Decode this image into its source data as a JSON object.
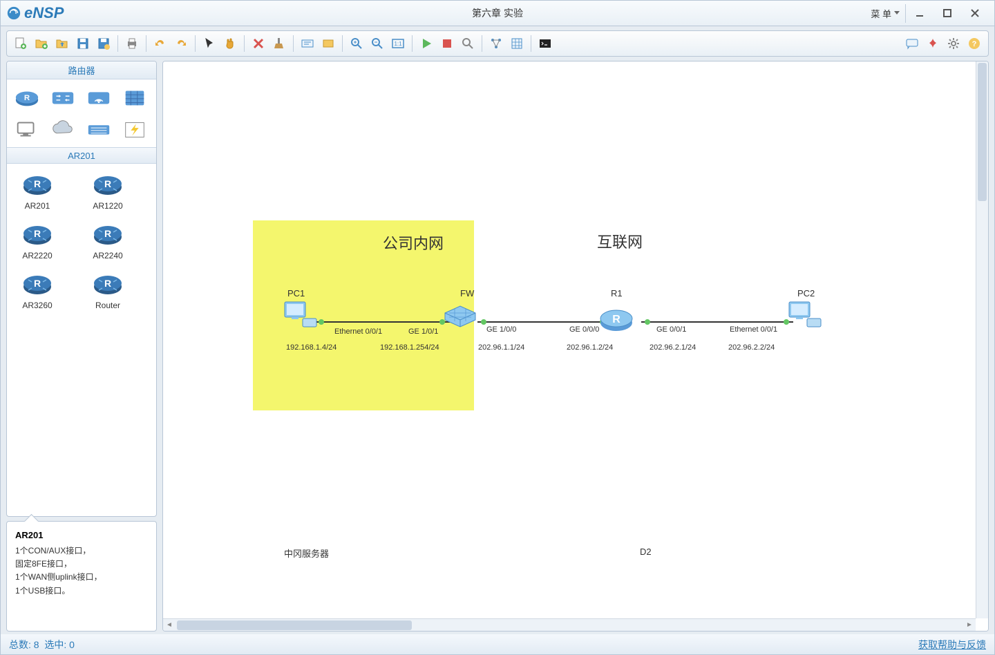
{
  "app": {
    "name": "eNSP",
    "title": "第六章 实验"
  },
  "menu": {
    "label": "菜  单"
  },
  "sidebar": {
    "category_title": "路由器",
    "selected_model": "AR201",
    "devices": [
      {
        "label": "AR201"
      },
      {
        "label": "AR1220"
      },
      {
        "label": "AR2220"
      },
      {
        "label": "AR2240"
      },
      {
        "label": "AR3260"
      },
      {
        "label": "Router"
      }
    ],
    "info": {
      "title": "AR201",
      "desc": "1个CON/AUX接口，\n固定8FE接口，\n1个WAN侧uplink接口，\n1个USB接口。"
    }
  },
  "topology": {
    "zones": [
      {
        "label": "公司内网",
        "color": "#f4f66d"
      },
      {
        "label": "互联网"
      }
    ],
    "nodes": [
      {
        "id": "PC1",
        "label": "PC1",
        "type": "pc"
      },
      {
        "id": "FW",
        "label": "FW",
        "type": "firewall"
      },
      {
        "id": "R1",
        "label": "R1",
        "type": "router"
      },
      {
        "id": "PC2",
        "label": "PC2",
        "type": "pc"
      }
    ],
    "ports": [
      "Ethernet 0/0/1",
      "GE 1/0/1",
      "GE 1/0/0",
      "GE 0/0/0",
      "GE 0/0/1",
      "Ethernet 0/0/1"
    ],
    "ips": [
      "192.168.1.4/24",
      "192.168.1.254/24",
      "202.96.1.1/24",
      "202.96.1.2/24",
      "202.96.2.1/24",
      "202.96.2.2/24"
    ],
    "partial_labels": {
      "left": "中冈服务器",
      "right": "D2"
    }
  },
  "status": {
    "total_label": "总数:",
    "total_value": "8",
    "selected_label": "选中:",
    "selected_value": "0",
    "feedback": "获取帮助与反馈"
  }
}
